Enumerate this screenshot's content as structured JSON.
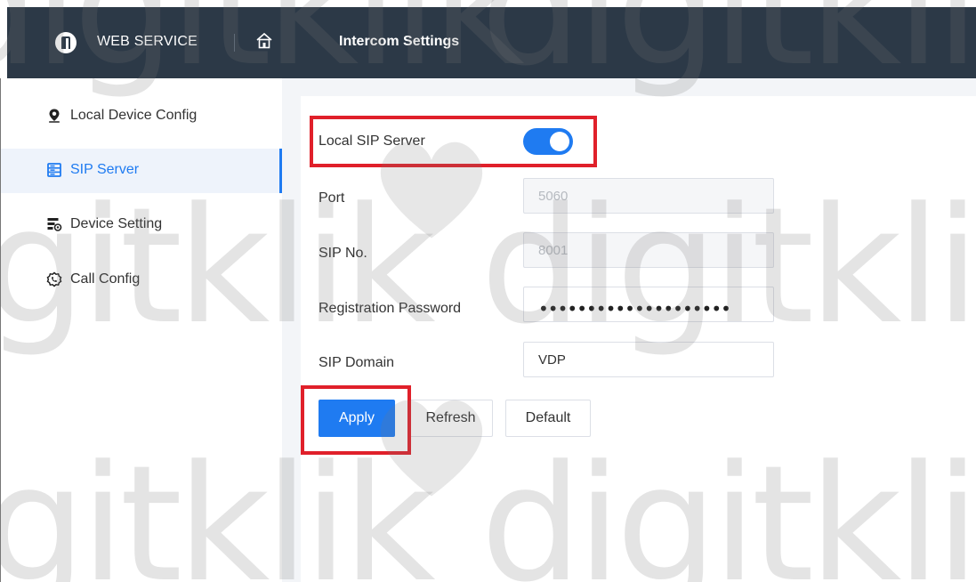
{
  "header": {
    "brand": "WEB SERVICE",
    "title": "Intercom Settings",
    "icons": [
      "logo-icon",
      "home-icon"
    ]
  },
  "sidebar": {
    "items": [
      {
        "label": "Local Device Config",
        "icon": "location-pin-icon",
        "active": false
      },
      {
        "label": "SIP Server",
        "icon": "server-icon",
        "active": true
      },
      {
        "label": "Device Setting",
        "icon": "device-settings-icon",
        "active": false
      },
      {
        "label": "Call Config",
        "icon": "call-config-icon",
        "active": false
      }
    ]
  },
  "form": {
    "local_sip_server": {
      "label": "Local SIP Server",
      "enabled": true
    },
    "port": {
      "label": "Port",
      "value": "5060",
      "disabled": true
    },
    "sip_no": {
      "label": "SIP No.",
      "value": "8001",
      "disabled": true
    },
    "registration_password": {
      "label": "Registration Password",
      "masked_value": "••••••••••••••••••••"
    },
    "sip_domain": {
      "label": "SIP Domain",
      "value": "VDP"
    }
  },
  "buttons": {
    "apply": "Apply",
    "refresh": "Refresh",
    "default": "Default"
  },
  "watermark": {
    "text": "digitklik"
  },
  "colors": {
    "header_bg": "#2c3947",
    "accent": "#1f7bf1",
    "highlight": "#e0202a",
    "content_bg": "#f3f5f8"
  }
}
